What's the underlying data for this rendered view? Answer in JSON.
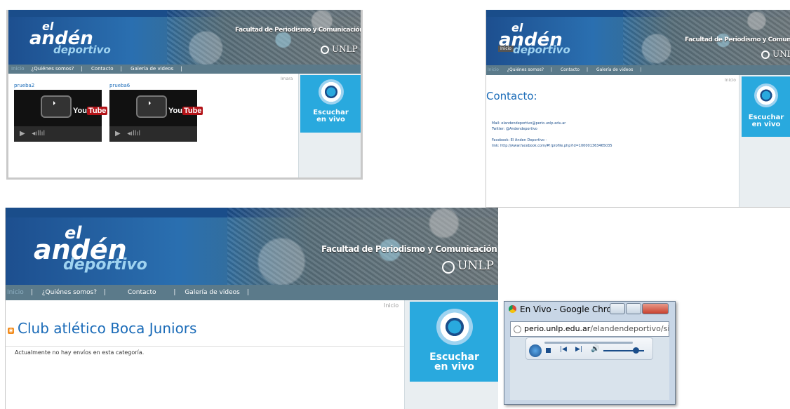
{
  "logo": {
    "el": "el",
    "anden": "andén",
    "deportivo": "deportivo"
  },
  "banner": {
    "facultad": "Facultad de Periodismo y Comunicación Social",
    "unlp": "UNLP"
  },
  "nav": {
    "inicio": "Inicio",
    "quienes_top": "¿Quiénes somos?",
    "contacto": "Contacto",
    "galeria": "Galería de videos",
    "quienes_bottom": "¿Quiénes somos?"
  },
  "radio": {
    "line1": "Escuchar",
    "line2": "en vivo"
  },
  "panel1": {
    "corner": "Imara",
    "videos": [
      {
        "title": "prueba2",
        "yt_you": "You",
        "yt_tube": "Tube"
      },
      {
        "title": "prueba6",
        "yt_you": "You",
        "yt_tube": "Tube"
      }
    ]
  },
  "panel2": {
    "corner": "Inicio",
    "inicio_badge": "Inicio",
    "title": "Contacto:",
    "mail": "Mail: elandendeportivo@perio.unlp.edu.ar",
    "twitter": "Twitter: @Andendeportivo",
    "facebook": "Facebook: El Anden Deportivo -",
    "link": "link: http://www.facebook.com/#!/profile.php?id=100001363465035"
  },
  "panel3": {
    "corner": "Inicio",
    "title": "Club atlético Boca Juniors",
    "message": "Actualmente no hay envíos en esta categoría.",
    "nav_sep": "|"
  },
  "chrome": {
    "title": "En Vivo - Google Chrome",
    "url_host": "perio.unlp.edu.ar",
    "url_path": "/elandendeportivo/sites/peri"
  }
}
